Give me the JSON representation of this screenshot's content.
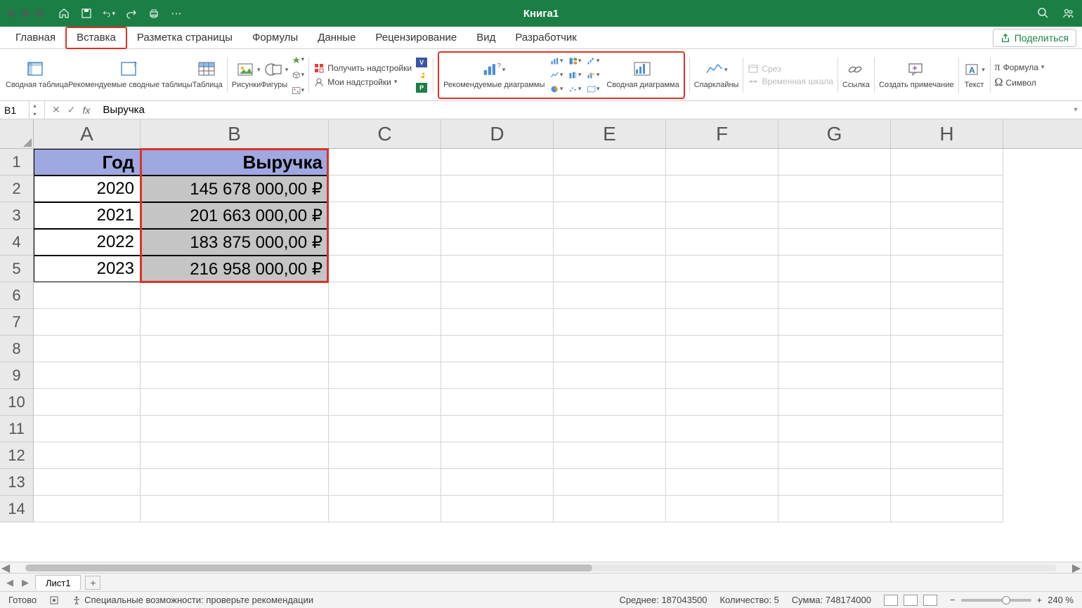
{
  "title": "Книга1",
  "tabs": [
    "Главная",
    "Вставка",
    "Разметка страницы",
    "Формулы",
    "Данные",
    "Рецензирование",
    "Вид",
    "Разработчик"
  ],
  "active_tab": "Вставка",
  "share_label": "Поделиться",
  "ribbon": {
    "pivot_table": "Сводная таблица",
    "recommended_pivot": "Рекомендуемые сводные таблицы",
    "table": "Таблица",
    "pictures": "Рисунки",
    "shapes": "Фигуры",
    "get_addins": "Получить надстройки",
    "my_addins": "Мои надстройки",
    "recommended_charts": "Рекомендуемые диаграммы",
    "pivot_chart": "Сводная диаграмма",
    "sparklines": "Спарклайны",
    "slicer": "Срез",
    "timeline": "Временная шкала",
    "link": "Ссылка",
    "comment": "Создать примечание",
    "text": "Текст",
    "equation": "Формула",
    "symbol": "Символ"
  },
  "name_box": "B1",
  "formula": "Выручка",
  "columns": [
    "A",
    "B",
    "C",
    "D",
    "E",
    "F",
    "G",
    "H"
  ],
  "row_count": 14,
  "data": {
    "headers": [
      "Год",
      "Выручка"
    ],
    "rows": [
      [
        "2020",
        "145 678 000,00 ₽"
      ],
      [
        "2021",
        "201 663 000,00 ₽"
      ],
      [
        "2022",
        "183 875 000,00 ₽"
      ],
      [
        "2023",
        "216 958 000,00 ₽"
      ]
    ]
  },
  "sheet_tab": "Лист1",
  "status": {
    "ready": "Готово",
    "accessibility": "Специальные возможности: проверьте рекомендации",
    "average": "Среднее: 187043500",
    "count": "Количество: 5",
    "sum": "Сумма: 748174000",
    "zoom": "240 %"
  }
}
